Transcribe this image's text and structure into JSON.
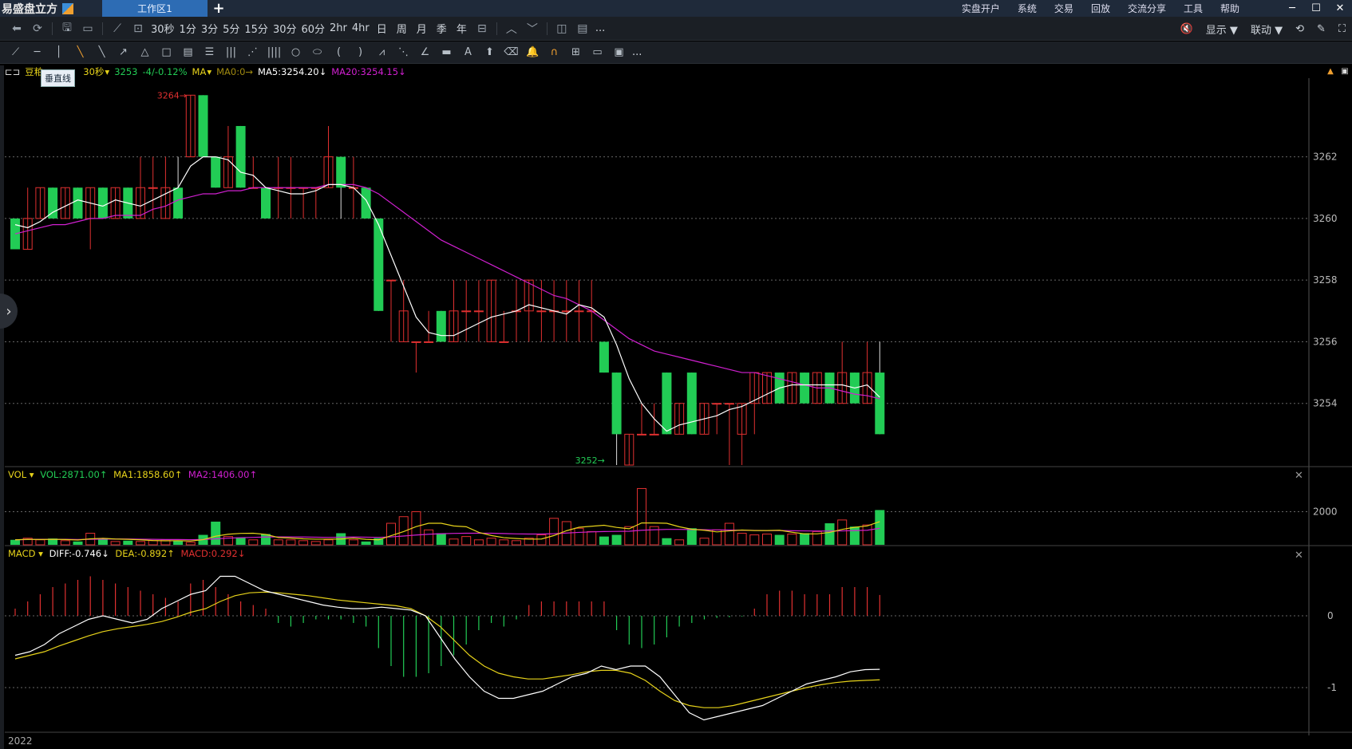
{
  "app": {
    "title": "易盛盘立方",
    "workspace_tab": "工作区1"
  },
  "menu": [
    "实盘开户",
    "系统",
    "交易",
    "回放",
    "交流分享",
    "工具",
    "帮助"
  ],
  "toolbar1": {
    "periods": [
      "30秒",
      "1分",
      "3分",
      "5分",
      "15分",
      "30分",
      "60分",
      "2hr",
      "4hr",
      "日",
      "周",
      "月",
      "季",
      "年"
    ],
    "more": "...",
    "display_label": "显示 ▼",
    "linkage_label": "联动 ▼"
  },
  "toolbar2": {
    "more": "..."
  },
  "tooltip": "垂直线",
  "info": {
    "symbol": "豆粕",
    "period": "30秒",
    "price": "3253",
    "change": "-4/-0.12%",
    "indicator": "MA",
    "ma0": "MA0:0→",
    "ma5": "MA5:3254.20↓",
    "ma20": "MA20:3254.15↓"
  },
  "vol_pane": {
    "name": "VOL",
    "vol": "VOL:2871.00↑",
    "ma1": "MA1:1858.60↑",
    "ma2": "MA2:1406.00↑"
  },
  "macd_pane": {
    "name": "MACD",
    "diff": "DIFF:-0.746↓",
    "dea": "DEA:-0.892↑",
    "macd": "MACD:0.292↓"
  },
  "footer_year": "2022",
  "colors": {
    "up": "#e03030",
    "down": "#22cc55",
    "ma5": "#ffffff",
    "ma20": "#d020d0",
    "ma1": "#e6d21a",
    "grid": "#666666"
  },
  "chart_data": [
    {
      "type": "candlestick",
      "title": "",
      "y_ticks": [
        3254,
        3256,
        3258,
        3260,
        3262
      ],
      "ylim": [
        3252,
        3264.5
      ],
      "annotations": [
        {
          "label": "3264",
          "value": 3264
        },
        {
          "label": "3252",
          "value": 3252
        }
      ],
      "candles": [
        {
          "o": 3260,
          "h": 3260,
          "l": 3259,
          "c": 3259
        },
        {
          "o": 3259,
          "h": 3261,
          "l": 3259,
          "c": 3260
        },
        {
          "o": 3260,
          "h": 3261,
          "l": 3260,
          "c": 3261
        },
        {
          "o": 3261,
          "h": 3261,
          "l": 3260,
          "c": 3260
        },
        {
          "o": 3260,
          "h": 3261,
          "l": 3260,
          "c": 3261
        },
        {
          "o": 3261,
          "h": 3261,
          "l": 3260,
          "c": 3260
        },
        {
          "o": 3260,
          "h": 3261,
          "l": 3259,
          "c": 3261
        },
        {
          "o": 3261,
          "h": 3261,
          "l": 3260,
          "c": 3260
        },
        {
          "o": 3260,
          "h": 3261,
          "l": 3260,
          "c": 3261
        },
        {
          "o": 3261,
          "h": 3261,
          "l": 3260,
          "c": 3260
        },
        {
          "o": 3260,
          "h": 3262,
          "l": 3260,
          "c": 3261
        },
        {
          "o": 3261,
          "h": 3262,
          "l": 3260,
          "c": 3261
        },
        {
          "o": 3260,
          "h": 3262,
          "l": 3260,
          "c": 3261
        },
        {
          "o": 3261,
          "h": 3262,
          "l": 3260,
          "c": 3260
        },
        {
          "o": 3262,
          "h": 3264,
          "l": 3262,
          "c": 3264
        },
        {
          "o": 3264,
          "h": 3264,
          "l": 3262,
          "c": 3262
        },
        {
          "o": 3262,
          "h": 3262,
          "l": 3261,
          "c": 3261
        },
        {
          "o": 3261,
          "h": 3263,
          "l": 3261,
          "c": 3262
        },
        {
          "o": 3263,
          "h": 3263,
          "l": 3261,
          "c": 3261
        },
        {
          "o": 3261,
          "h": 3262,
          "l": 3261,
          "c": 3261
        },
        {
          "o": 3261,
          "h": 3261,
          "l": 3260,
          "c": 3260
        },
        {
          "o": 3261,
          "h": 3262,
          "l": 3260,
          "c": 3261
        },
        {
          "o": 3261,
          "h": 3262,
          "l": 3260,
          "c": 3261
        },
        {
          "o": 3261,
          "h": 3261,
          "l": 3260,
          "c": 3261
        },
        {
          "o": 3261,
          "h": 3261,
          "l": 3260,
          "c": 3261
        },
        {
          "o": 3261,
          "h": 3263,
          "l": 3261,
          "c": 3262
        },
        {
          "o": 3262,
          "h": 3262,
          "l": 3260,
          "c": 3261
        },
        {
          "o": 3261,
          "h": 3262,
          "l": 3260,
          "c": 3261
        },
        {
          "o": 3261,
          "h": 3261,
          "l": 3260,
          "c": 3260
        },
        {
          "o": 3260,
          "h": 3260,
          "l": 3257,
          "c": 3257
        },
        {
          "o": 3258,
          "h": 3258,
          "l": 3256,
          "c": 3258
        },
        {
          "o": 3256,
          "h": 3258,
          "l": 3256,
          "c": 3257
        },
        {
          "o": 3256,
          "h": 3256,
          "l": 3255,
          "c": 3256
        },
        {
          "o": 3256,
          "h": 3257,
          "l": 3256,
          "c": 3256
        },
        {
          "o": 3257,
          "h": 3257,
          "l": 3256,
          "c": 3256
        },
        {
          "o": 3256,
          "h": 3258,
          "l": 3256,
          "c": 3257
        },
        {
          "o": 3257,
          "h": 3258,
          "l": 3256,
          "c": 3257
        },
        {
          "o": 3257,
          "h": 3258,
          "l": 3256,
          "c": 3257
        },
        {
          "o": 3256,
          "h": 3258,
          "l": 3256,
          "c": 3258
        },
        {
          "o": 3256,
          "h": 3257,
          "l": 3256,
          "c": 3256
        },
        {
          "o": 3257,
          "h": 3258,
          "l": 3256,
          "c": 3257
        },
        {
          "o": 3257,
          "h": 3258,
          "l": 3256,
          "c": 3258
        },
        {
          "o": 3257,
          "h": 3258,
          "l": 3256,
          "c": 3257
        },
        {
          "o": 3257,
          "h": 3258,
          "l": 3256,
          "c": 3257
        },
        {
          "o": 3257,
          "h": 3258,
          "l": 3256,
          "c": 3257
        },
        {
          "o": 3257,
          "h": 3258,
          "l": 3256,
          "c": 3257
        },
        {
          "o": 3257,
          "h": 3258,
          "l": 3256,
          "c": 3257
        },
        {
          "o": 3256,
          "h": 3256,
          "l": 3255,
          "c": 3255
        },
        {
          "o": 3255,
          "h": 3255,
          "l": 3252,
          "c": 3253
        },
        {
          "o": 3252,
          "h": 3253,
          "l": 3252,
          "c": 3253
        },
        {
          "o": 3253,
          "h": 3254,
          "l": 3253,
          "c": 3253
        },
        {
          "o": 3253,
          "h": 3254,
          "l": 3253,
          "c": 3253
        },
        {
          "o": 3255,
          "h": 3255,
          "l": 3253,
          "c": 3253
        },
        {
          "o": 3253,
          "h": 3254,
          "l": 3253,
          "c": 3254
        },
        {
          "o": 3255,
          "h": 3255,
          "l": 3253,
          "c": 3253
        },
        {
          "o": 3253,
          "h": 3254,
          "l": 3253,
          "c": 3254
        },
        {
          "o": 3254,
          "h": 3254,
          "l": 3253,
          "c": 3254
        },
        {
          "o": 3254,
          "h": 3254,
          "l": 3252,
          "c": 3254
        },
        {
          "o": 3253,
          "h": 3254,
          "l": 3252,
          "c": 3254
        },
        {
          "o": 3254,
          "h": 3255,
          "l": 3253,
          "c": 3255
        },
        {
          "o": 3254,
          "h": 3255,
          "l": 3254,
          "c": 3255
        },
        {
          "o": 3255,
          "h": 3255,
          "l": 3254,
          "c": 3254
        },
        {
          "o": 3254,
          "h": 3255,
          "l": 3254,
          "c": 3255
        },
        {
          "o": 3255,
          "h": 3255,
          "l": 3254,
          "c": 3254
        },
        {
          "o": 3254,
          "h": 3255,
          "l": 3254,
          "c": 3255
        },
        {
          "o": 3255,
          "h": 3255,
          "l": 3254,
          "c": 3254
        },
        {
          "o": 3254,
          "h": 3256,
          "l": 3254,
          "c": 3255
        },
        {
          "o": 3255,
          "h": 3255,
          "l": 3254,
          "c": 3254
        },
        {
          "o": 3254,
          "h": 3256,
          "l": 3254,
          "c": 3255
        },
        {
          "o": 3255,
          "h": 3256,
          "l": 3253,
          "c": 3253
        }
      ],
      "ma5": [
        3259.8,
        3259.7,
        3259.9,
        3260.2,
        3260.4,
        3260.6,
        3260.5,
        3260.4,
        3260.6,
        3260.5,
        3260.4,
        3260.6,
        3260.8,
        3261,
        3261.7,
        3262,
        3262,
        3261.9,
        3261.5,
        3261.4,
        3261,
        3260.9,
        3260.8,
        3260.8,
        3260.9,
        3261.1,
        3261.1,
        3261,
        3260.6,
        3259.8,
        3258.8,
        3257.8,
        3256.8,
        3256.3,
        3256.2,
        3256.2,
        3256.4,
        3256.6,
        3256.8,
        3256.9,
        3257,
        3257.2,
        3257.1,
        3257,
        3256.9,
        3257.2,
        3257.1,
        3256.8,
        3255.9,
        3254.8,
        3254,
        3253.5,
        3253.1,
        3253.3,
        3253.4,
        3253.5,
        3253.6,
        3253.8,
        3253.9,
        3254.1,
        3254.3,
        3254.5,
        3254.6,
        3254.6,
        3254.6,
        3254.6,
        3254.6,
        3254.5,
        3254.6,
        3254.2
      ],
      "ma20": [
        3259.5,
        3259.6,
        3259.7,
        3259.8,
        3259.8,
        3259.9,
        3260,
        3260,
        3260.1,
        3260.1,
        3260.1,
        3260.3,
        3260.4,
        3260.6,
        3260.7,
        3260.8,
        3260.8,
        3260.9,
        3260.9,
        3261,
        3261,
        3261,
        3261,
        3261,
        3261,
        3261.1,
        3261.1,
        3261.1,
        3261,
        3260.8,
        3260.5,
        3260.2,
        3259.9,
        3259.6,
        3259.3,
        3259.1,
        3258.9,
        3258.7,
        3258.5,
        3258.3,
        3258.1,
        3257.9,
        3257.7,
        3257.5,
        3257.4,
        3257.2,
        3257,
        3256.7,
        3256.4,
        3256.1,
        3255.9,
        3255.7,
        3255.6,
        3255.5,
        3255.4,
        3255.3,
        3255.2,
        3255.1,
        3255,
        3255,
        3254.9,
        3254.8,
        3254.7,
        3254.6,
        3254.5,
        3254.5,
        3254.4,
        3254.3,
        3254.25,
        3254.15
      ]
    },
    {
      "type": "bar",
      "title": "VOL",
      "y_ticks": [
        2000
      ],
      "ylim": [
        0,
        4000
      ],
      "values": [
        300,
        400,
        300,
        380,
        250,
        200,
        700,
        400,
        200,
        250,
        200,
        250,
        300,
        250,
        150,
        600,
        1400,
        500,
        450,
        300,
        650,
        300,
        300,
        250,
        200,
        300,
        700,
        300,
        200,
        400,
        1300,
        1700,
        2000,
        900,
        700,
        350,
        500,
        300,
        400,
        300,
        250,
        400,
        600,
        1600,
        1400,
        1000,
        800,
        500,
        600,
        1100,
        3400,
        1100,
        400,
        300,
        1000,
        400,
        900,
        1300,
        700,
        600,
        650,
        600,
        650,
        700,
        800,
        1300,
        1500,
        1100,
        1200,
        2100
      ],
      "ma1": [
        300,
        330,
        320,
        330,
        320,
        290,
        360,
        390,
        350,
        330,
        300,
        260,
        240,
        250,
        230,
        310,
        520,
        640,
        690,
        700,
        630,
        440,
        410,
        360,
        340,
        340,
        350,
        400,
        330,
        300,
        550,
        800,
        1100,
        1300,
        1300,
        1140,
        1090,
        750,
        560,
        430,
        380,
        340,
        350,
        560,
        850,
        1060,
        1120,
        1180,
        1050,
        970,
        1320,
        1320,
        1300,
        1090,
        940,
        880,
        780,
        840,
        890,
        860,
        860,
        880,
        760,
        660,
        660,
        750,
        930,
        1060,
        1140,
        1400
      ],
      "ma2": [
        300,
        320,
        330,
        330,
        330,
        320,
        330,
        340,
        350,
        350,
        340,
        330,
        320,
        320,
        310,
        320,
        360,
        400,
        430,
        450,
        470,
        480,
        480,
        470,
        460,
        450,
        460,
        470,
        460,
        450,
        480,
        530,
        590,
        640,
        670,
        690,
        700,
        700,
        700,
        680,
        660,
        650,
        650,
        670,
        710,
        750,
        780,
        800,
        810,
        820,
        880,
        910,
        930,
        930,
        920,
        910,
        900,
        890,
        880,
        870,
        860,
        860,
        850,
        840,
        830,
        830,
        840,
        860,
        880,
        1000
      ]
    },
    {
      "type": "bar",
      "title": "MACD",
      "y_ticks": [
        0,
        -1
      ],
      "ylim": [
        -1.6,
        0.8
      ],
      "macd_bars": [
        0.1,
        0.2,
        0.3,
        0.4,
        0.45,
        0.5,
        0.55,
        0.5,
        0.45,
        0.4,
        0.35,
        0.3,
        0.25,
        0.2,
        0.45,
        0.5,
        0.4,
        0.3,
        0.2,
        0.15,
        0.1,
        -0.1,
        -0.15,
        -0.1,
        -0.05,
        -0.05,
        -0.05,
        -0.1,
        -0.15,
        -0.45,
        -0.7,
        -0.85,
        -0.85,
        -0.8,
        -0.7,
        -0.55,
        -0.4,
        -0.2,
        -0.1,
        -0.15,
        -0.05,
        0.15,
        0.2,
        0.2,
        0.2,
        0.2,
        0.2,
        0.2,
        -0.2,
        -0.4,
        -0.45,
        -0.4,
        -0.3,
        -0.15,
        -0.1,
        -0.05,
        -0.03,
        -0.02,
        -0.01,
        0.1,
        0.3,
        0.35,
        0.35,
        0.3,
        0.3,
        0.3,
        0.4,
        0.4,
        0.4,
        0.29
      ],
      "diff": [
        -0.55,
        -0.5,
        -0.4,
        -0.25,
        -0.15,
        -0.05,
        0.0,
        -0.05,
        -0.1,
        -0.05,
        0.1,
        0.2,
        0.3,
        0.35,
        0.55,
        0.55,
        0.45,
        0.35,
        0.3,
        0.25,
        0.2,
        0.15,
        0.12,
        0.1,
        0.1,
        0.12,
        0.1,
        0.08,
        0.0,
        -0.3,
        -0.6,
        -0.85,
        -1.05,
        -1.15,
        -1.15,
        -1.1,
        -1.05,
        -0.95,
        -0.85,
        -0.8,
        -0.7,
        -0.75,
        -0.7,
        -0.7,
        -0.85,
        -1.1,
        -1.35,
        -1.45,
        -1.4,
        -1.35,
        -1.3,
        -1.25,
        -1.15,
        -1.05,
        -0.95,
        -0.9,
        -0.85,
        -0.78,
        -0.75,
        -0.746
      ],
      "dea": [
        -0.6,
        -0.55,
        -0.5,
        -0.42,
        -0.35,
        -0.28,
        -0.22,
        -0.18,
        -0.15,
        -0.12,
        -0.08,
        -0.02,
        0.05,
        0.1,
        0.2,
        0.28,
        0.32,
        0.33,
        0.32,
        0.3,
        0.28,
        0.25,
        0.22,
        0.2,
        0.18,
        0.16,
        0.14,
        0.1,
        0.0,
        -0.15,
        -0.35,
        -0.55,
        -0.7,
        -0.8,
        -0.85,
        -0.88,
        -0.88,
        -0.85,
        -0.82,
        -0.78,
        -0.76,
        -0.76,
        -0.8,
        -0.9,
        -1.05,
        -1.18,
        -1.25,
        -1.28,
        -1.28,
        -1.25,
        -1.2,
        -1.15,
        -1.1,
        -1.05,
        -1.0,
        -0.96,
        -0.93,
        -0.91,
        -0.9,
        -0.892
      ]
    }
  ]
}
